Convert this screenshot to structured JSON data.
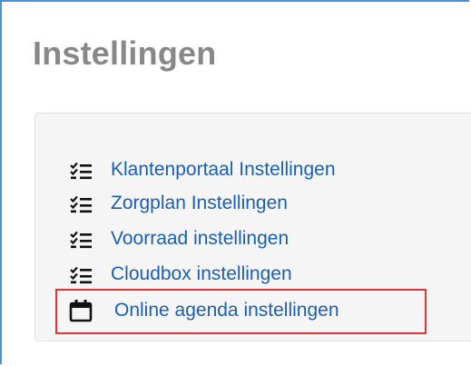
{
  "page": {
    "title": "Instellingen"
  },
  "settings_links": [
    {
      "label": "Klantenportaal Instellingen",
      "icon": "checklist-icon"
    },
    {
      "label": "Zorgplan Instellingen",
      "icon": "checklist-icon"
    },
    {
      "label": "Voorraad instellingen",
      "icon": "checklist-icon"
    },
    {
      "label": "Cloudbox instellingen",
      "icon": "checklist-icon"
    },
    {
      "label": "Online agenda instellingen",
      "icon": "calendar-icon"
    }
  ],
  "colors": {
    "link": "#1a5fb4",
    "title": "#888888",
    "highlight_border": "#e0343a",
    "panel_bg": "#f5f5f5",
    "frame_border": "#4f8fd6"
  }
}
